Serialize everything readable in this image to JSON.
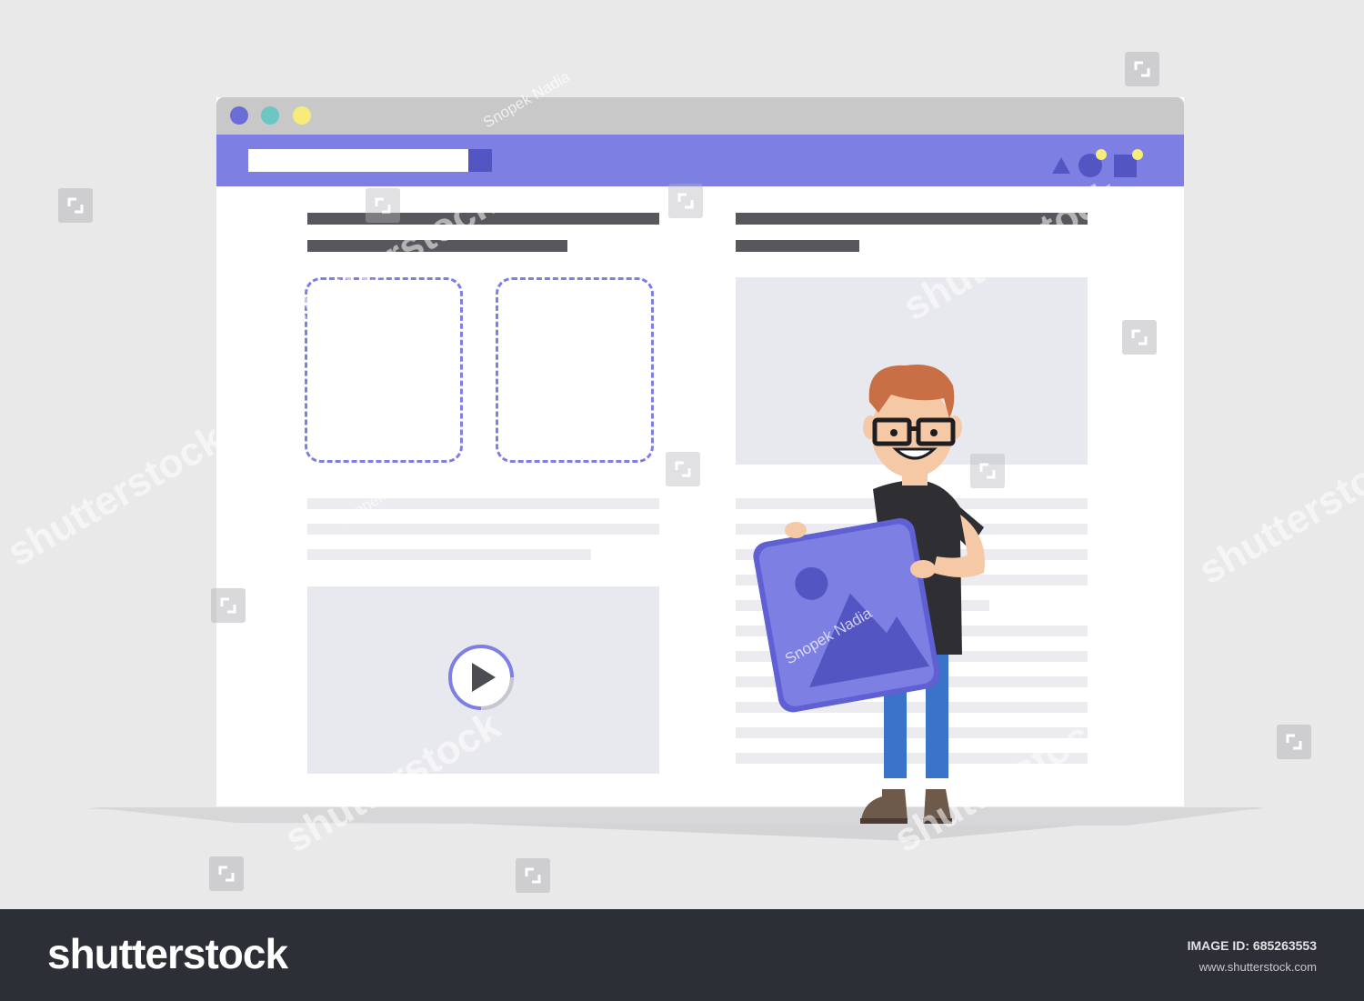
{
  "colors": {
    "background": "#e9e9ea",
    "accent": "#7d7fe2",
    "accent_dark": "#5355c3",
    "window_dot_1": "#6b6dd6",
    "window_dot_2": "#6bc6c4",
    "window_dot_3": "#f5ec7c",
    "footer": "#2d2f36"
  },
  "icons": {
    "play": "play-icon",
    "image": "image-icon",
    "nav": [
      "triangle-icon",
      "circle-icon",
      "square-icon"
    ]
  },
  "watermark": {
    "brand": "shutterstock",
    "credit": "Snopek Nadia"
  },
  "footer": {
    "brand": "shutterstock",
    "image_id_label": "IMAGE ID:",
    "image_id": "685263553",
    "site": "www.shutterstock.com"
  }
}
